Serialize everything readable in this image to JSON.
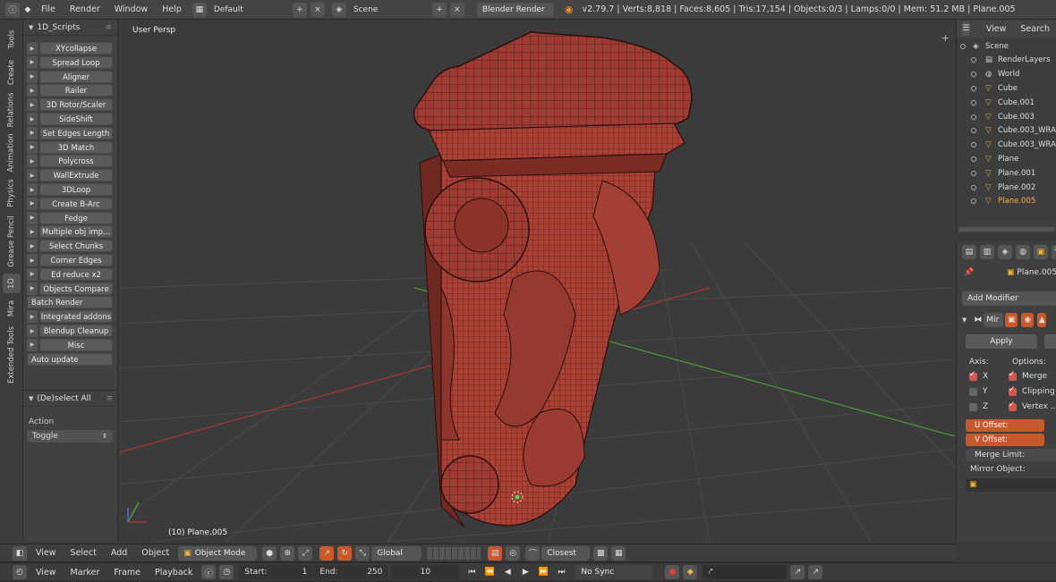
{
  "menubar": {
    "items": [
      "File",
      "Render",
      "Window",
      "Help"
    ],
    "layout": "Default",
    "scene": "Scene",
    "engine": "Blender Render",
    "stats": "v2.79.7 | Verts:8,818 | Faces:8,605 | Tris:17,154 | Objects:0/3 | Lamps:0/0 | Mem: 51.2 MB | Plane.005"
  },
  "tabs": [
    "Tools",
    "Create",
    "Relations",
    "Animation",
    "Physics",
    "Grease Pencil",
    "1D",
    "Mira",
    "Extended Tools"
  ],
  "shelf": {
    "title": "1D_Scripts",
    "tools": [
      "XYcollapse",
      "Spread Loop",
      "Aligner",
      "Railer",
      "3D Rotor/Scaler",
      "SideShift",
      "Set Edges Length",
      "3D Match",
      "Polycross",
      "WallExtrude",
      "3DLoop",
      "Create B-Arc",
      "Fedge",
      "Multiple obj imp...",
      "Select Chunks",
      "Corner Edges",
      "Ed reduce x2",
      "Objects Compare",
      "Batch Render",
      "Integrated addons",
      "Blendup Cleanup",
      "Misc",
      "Auto update"
    ],
    "operator_title": "(De)select All",
    "action_label": "Action",
    "action_value": "Toggle"
  },
  "viewport": {
    "view_name": "User Persp",
    "object_label": "(10) Plane.005"
  },
  "header3d": {
    "menus": [
      "View",
      "Select",
      "Add",
      "Object"
    ],
    "mode": "Object Mode",
    "orientation": "Global",
    "snap": "Closest"
  },
  "timeline": {
    "menus": [
      "View",
      "Marker",
      "Frame",
      "Playback"
    ],
    "start_label": "Start:",
    "start": "1",
    "end_label": "End:",
    "end": "250",
    "current": "10",
    "sync": "No Sync"
  },
  "outliner": {
    "menus": [
      "View",
      "Search"
    ],
    "items": [
      {
        "name": "Scene",
        "indent": 0,
        "icon": "scene"
      },
      {
        "name": "RenderLayers",
        "indent": 1,
        "icon": "layers"
      },
      {
        "name": "World",
        "indent": 1,
        "icon": "world"
      },
      {
        "name": "Cube",
        "indent": 1,
        "icon": "mesh"
      },
      {
        "name": "Cube.001",
        "indent": 1,
        "icon": "mesh"
      },
      {
        "name": "Cube.003",
        "indent": 1,
        "icon": "mesh"
      },
      {
        "name": "Cube.003_WRA",
        "indent": 1,
        "icon": "mesh"
      },
      {
        "name": "Cube.003_WRA",
        "indent": 1,
        "icon": "mesh"
      },
      {
        "name": "Plane",
        "indent": 1,
        "icon": "mesh"
      },
      {
        "name": "Plane.001",
        "indent": 1,
        "icon": "mesh"
      },
      {
        "name": "Plane.002",
        "indent": 1,
        "icon": "mesh"
      },
      {
        "name": "Plane.005",
        "indent": 1,
        "icon": "mesh",
        "selected": true
      }
    ]
  },
  "properties": {
    "object": "Plane.005",
    "add_modifier": "Add Modifier",
    "modifier_name": "Mir",
    "apply": "Apply",
    "axis_label": "Axis:",
    "options_label": "Options:",
    "axes": [
      {
        "label": "X",
        "on": true
      },
      {
        "label": "Y",
        "on": false
      },
      {
        "label": "Z",
        "on": false
      }
    ],
    "options": [
      {
        "label": "Merge",
        "on": true
      },
      {
        "label": "Clipping",
        "on": true
      },
      {
        "label": "Vertex ...",
        "on": true
      }
    ],
    "u_offset": "U Offset:",
    "v_offset": "V Offset:",
    "merge_limit": "Merge Limit:",
    "mirror_object": "Mirror Object:"
  },
  "colors": {
    "model": "#9e3b32",
    "accent": "#c8582e",
    "selected": "#f0b43c"
  }
}
